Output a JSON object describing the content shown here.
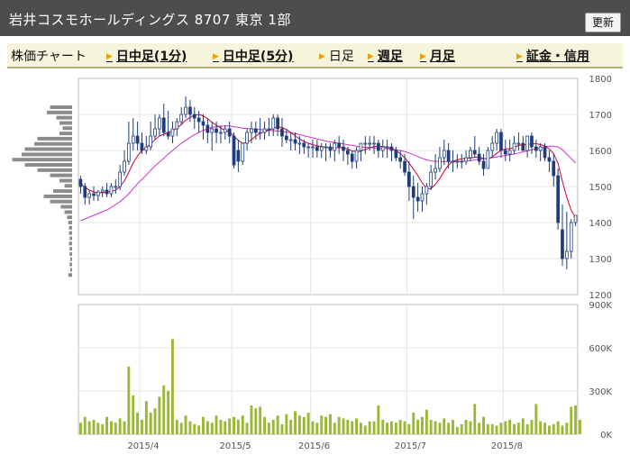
{
  "header": {
    "title": "岩井コスモホールディングス  8707  東京 1部",
    "refresh_label": "更新"
  },
  "tabs": [
    {
      "label": "株価チャート",
      "link": false,
      "arrow": false
    },
    {
      "label": "日中足(1分)",
      "link": true,
      "arrow": true
    },
    {
      "label": "日中足(5分)",
      "link": true,
      "arrow": true
    },
    {
      "label": "日足",
      "link": false,
      "arrow": true
    },
    {
      "label": "週足",
      "link": true,
      "arrow": true
    },
    {
      "label": "月足",
      "link": true,
      "arrow": true
    },
    {
      "label": "証金・信用",
      "link": true,
      "arrow": true
    }
  ],
  "colors": {
    "up_candle": "#ffffff",
    "down_candle": "#1f3d7a",
    "ma_short": "#cc0033",
    "ma_long": "#cc33cc",
    "volume": "#99b833",
    "grid": "#e6e6e6",
    "profile": "#8c8c8c"
  },
  "chart_data": [
    {
      "type": "candlestick",
      "title": "",
      "ylim": [
        1200,
        1800
      ],
      "yticks": [
        "1800",
        "1700",
        "1600",
        "1500",
        "1400",
        "1300",
        "1200"
      ],
      "xticks": [
        "2015/4",
        "2015/5",
        "2015/6",
        "2015/7",
        "2015/8"
      ],
      "x": [
        "2015/3/12",
        "2015/3/13",
        "2015/3/16",
        "2015/3/17",
        "2015/3/18",
        "2015/3/19",
        "2015/3/20",
        "2015/3/23",
        "2015/3/24",
        "2015/3/25",
        "2015/3/26",
        "2015/3/27",
        "2015/3/30",
        "2015/3/31",
        "2015/4/1",
        "2015/4/2",
        "2015/4/3",
        "2015/4/6",
        "2015/4/7",
        "2015/4/8",
        "2015/4/9",
        "2015/4/10",
        "2015/4/13",
        "2015/4/14",
        "2015/4/15",
        "2015/4/16",
        "2015/4/17",
        "2015/4/20",
        "2015/4/21",
        "2015/4/22",
        "2015/4/23",
        "2015/4/24",
        "2015/4/27",
        "2015/4/28",
        "2015/4/30",
        "2015/5/1",
        "2015/5/7",
        "2015/5/8",
        "2015/5/11",
        "2015/5/12",
        "2015/5/13",
        "2015/5/14",
        "2015/5/15",
        "2015/5/18",
        "2015/5/19",
        "2015/5/20",
        "2015/5/21",
        "2015/5/22",
        "2015/5/25",
        "2015/5/26",
        "2015/5/27",
        "2015/5/28",
        "2015/5/29",
        "2015/6/1",
        "2015/6/2",
        "2015/6/3",
        "2015/6/4",
        "2015/6/5",
        "2015/6/8",
        "2015/6/9",
        "2015/6/10",
        "2015/6/11",
        "2015/6/12",
        "2015/6/15",
        "2015/6/16",
        "2015/6/17",
        "2015/6/18",
        "2015/6/19",
        "2015/6/22",
        "2015/6/23",
        "2015/6/24",
        "2015/6/25",
        "2015/6/26",
        "2015/6/29",
        "2015/6/30",
        "2015/7/1",
        "2015/7/2",
        "2015/7/3",
        "2015/7/6",
        "2015/7/7",
        "2015/7/8",
        "2015/7/9",
        "2015/7/10",
        "2015/7/13",
        "2015/7/14",
        "2015/7/15",
        "2015/7/16",
        "2015/7/17",
        "2015/7/21",
        "2015/7/22",
        "2015/7/23",
        "2015/7/24",
        "2015/7/27",
        "2015/7/28",
        "2015/7/29",
        "2015/7/30",
        "2015/7/31",
        "2015/8/3",
        "2015/8/4",
        "2015/8/5",
        "2015/8/6",
        "2015/8/7",
        "2015/8/10",
        "2015/8/11",
        "2015/8/12",
        "2015/8/13",
        "2015/8/14",
        "2015/8/17",
        "2015/8/18",
        "2015/8/19",
        "2015/8/20",
        "2015/8/21",
        "2015/8/24",
        "2015/8/25",
        "2015/8/26",
        "2015/8/27"
      ],
      "open": [
        1520,
        1500,
        1470,
        1480,
        1475,
        1485,
        1490,
        1480,
        1500,
        1500,
        1540,
        1570,
        1620,
        1640,
        1620,
        1600,
        1610,
        1640,
        1660,
        1690,
        1650,
        1640,
        1660,
        1680,
        1700,
        1720,
        1700,
        1690,
        1680,
        1670,
        1650,
        1660,
        1650,
        1650,
        1660,
        1640,
        1600,
        1570,
        1620,
        1650,
        1660,
        1650,
        1650,
        1660,
        1660,
        1690,
        1660,
        1640,
        1630,
        1630,
        1620,
        1620,
        1610,
        1610,
        1610,
        1600,
        1610,
        1610,
        1600,
        1620,
        1610,
        1600,
        1590,
        1570,
        1600,
        1620,
        1620,
        1620,
        1620,
        1600,
        1610,
        1610,
        1600,
        1580,
        1570,
        1540,
        1500,
        1470,
        1460,
        1480,
        1500,
        1540,
        1550,
        1580,
        1600,
        1570,
        1570,
        1570,
        1570,
        1580,
        1600,
        1590,
        1570,
        1550,
        1600,
        1620,
        1650,
        1600,
        1590,
        1600,
        1620,
        1620,
        1600,
        1640,
        1610,
        1600,
        1610,
        1580,
        1570,
        1530,
        1380,
        1300,
        1320,
        1400
      ],
      "high": [
        1530,
        1510,
        1490,
        1500,
        1490,
        1500,
        1510,
        1510,
        1520,
        1560,
        1600,
        1680,
        1690,
        1680,
        1650,
        1640,
        1680,
        1700,
        1700,
        1730,
        1710,
        1680,
        1690,
        1720,
        1750,
        1740,
        1720,
        1710,
        1700,
        1690,
        1680,
        1680,
        1670,
        1670,
        1680,
        1650,
        1630,
        1620,
        1660,
        1680,
        1680,
        1690,
        1680,
        1690,
        1700,
        1700,
        1690,
        1660,
        1650,
        1650,
        1640,
        1630,
        1620,
        1630,
        1630,
        1620,
        1620,
        1620,
        1630,
        1640,
        1630,
        1610,
        1600,
        1610,
        1620,
        1640,
        1640,
        1640,
        1630,
        1630,
        1630,
        1620,
        1610,
        1600,
        1590,
        1570,
        1530,
        1510,
        1500,
        1510,
        1560,
        1590,
        1610,
        1630,
        1620,
        1600,
        1590,
        1590,
        1600,
        1610,
        1640,
        1610,
        1590,
        1610,
        1640,
        1660,
        1660,
        1630,
        1630,
        1640,
        1650,
        1640,
        1640,
        1650,
        1630,
        1620,
        1620,
        1600,
        1590,
        1550,
        1450,
        1430,
        1410,
        1420
      ],
      "low": [
        1480,
        1450,
        1450,
        1460,
        1460,
        1470,
        1470,
        1470,
        1480,
        1490,
        1530,
        1560,
        1600,
        1600,
        1590,
        1590,
        1600,
        1630,
        1640,
        1640,
        1630,
        1620,
        1640,
        1670,
        1690,
        1680,
        1660,
        1650,
        1630,
        1620,
        1600,
        1620,
        1620,
        1630,
        1620,
        1550,
        1540,
        1560,
        1600,
        1620,
        1630,
        1630,
        1630,
        1640,
        1640,
        1640,
        1610,
        1620,
        1600,
        1600,
        1590,
        1590,
        1580,
        1580,
        1580,
        1580,
        1570,
        1580,
        1570,
        1590,
        1570,
        1560,
        1550,
        1550,
        1570,
        1590,
        1600,
        1590,
        1580,
        1580,
        1580,
        1570,
        1570,
        1550,
        1530,
        1460,
        1410,
        1430,
        1430,
        1450,
        1490,
        1520,
        1540,
        1560,
        1550,
        1540,
        1550,
        1550,
        1560,
        1570,
        1580,
        1560,
        1530,
        1550,
        1580,
        1600,
        1580,
        1570,
        1570,
        1590,
        1600,
        1600,
        1580,
        1590,
        1580,
        1570,
        1570,
        1540,
        1500,
        1380,
        1280,
        1270,
        1300,
        1390
      ],
      "close": [
        1500,
        1470,
        1480,
        1475,
        1485,
        1490,
        1480,
        1500,
        1500,
        1540,
        1570,
        1620,
        1640,
        1620,
        1600,
        1610,
        1640,
        1660,
        1690,
        1650,
        1640,
        1660,
        1680,
        1700,
        1720,
        1700,
        1690,
        1680,
        1670,
        1650,
        1660,
        1650,
        1650,
        1660,
        1640,
        1560,
        1570,
        1620,
        1650,
        1660,
        1650,
        1650,
        1660,
        1660,
        1690,
        1660,
        1640,
        1630,
        1630,
        1620,
        1620,
        1610,
        1610,
        1610,
        1600,
        1610,
        1610,
        1600,
        1620,
        1610,
        1600,
        1590,
        1570,
        1600,
        1620,
        1620,
        1620,
        1620,
        1600,
        1610,
        1610,
        1600,
        1580,
        1570,
        1540,
        1500,
        1470,
        1460,
        1480,
        1500,
        1540,
        1550,
        1580,
        1600,
        1570,
        1570,
        1570,
        1570,
        1580,
        1600,
        1590,
        1570,
        1550,
        1600,
        1620,
        1650,
        1600,
        1590,
        1600,
        1620,
        1620,
        1600,
        1640,
        1610,
        1600,
        1610,
        1580,
        1570,
        1530,
        1400,
        1300,
        1320,
        1400,
        1420
      ],
      "ma_short": [
        1508,
        1498,
        1490,
        1485,
        1482,
        1483,
        1484,
        1486,
        1490,
        1500,
        1515,
        1540,
        1565,
        1585,
        1600,
        1608,
        1618,
        1630,
        1640,
        1645,
        1650,
        1655,
        1662,
        1672,
        1684,
        1692,
        1698,
        1700,
        1696,
        1688,
        1678,
        1670,
        1662,
        1656,
        1652,
        1640,
        1628,
        1620,
        1622,
        1630,
        1640,
        1648,
        1652,
        1656,
        1662,
        1665,
        1664,
        1658,
        1650,
        1640,
        1632,
        1625,
        1620,
        1616,
        1613,
        1611,
        1609,
        1607,
        1607,
        1608,
        1607,
        1604,
        1599,
        1596,
        1598,
        1603,
        1607,
        1611,
        1612,
        1611,
        1609,
        1606,
        1600,
        1591,
        1580,
        1565,
        1548,
        1530,
        1510,
        1494,
        1494,
        1506,
        1522,
        1542,
        1560,
        1570,
        1574,
        1577,
        1578,
        1579,
        1581,
        1582,
        1578,
        1576,
        1582,
        1592,
        1601,
        1604,
        1605,
        1608,
        1614,
        1616,
        1616,
        1619,
        1619,
        1616,
        1613,
        1604,
        1591,
        1564,
        1514,
        1470,
        1434,
        1414
      ],
      "ma_long": [
        1405,
        1410,
        1415,
        1420,
        1425,
        1430,
        1435,
        1442,
        1450,
        1458,
        1468,
        1480,
        1494,
        1508,
        1520,
        1532,
        1545,
        1557,
        1568,
        1578,
        1590,
        1600,
        1610,
        1620,
        1628,
        1636,
        1644,
        1650,
        1656,
        1660,
        1664,
        1666,
        1667,
        1668,
        1668,
        1666,
        1664,
        1662,
        1661,
        1660,
        1659,
        1658,
        1657,
        1656,
        1655,
        1654,
        1653,
        1651,
        1649,
        1647,
        1644,
        1641,
        1638,
        1635,
        1632,
        1629,
        1626,
        1624,
        1622,
        1620,
        1618,
        1616,
        1614,
        1612,
        1610,
        1609,
        1608,
        1607,
        1606,
        1606,
        1605,
        1604,
        1602,
        1600,
        1597,
        1593,
        1588,
        1583,
        1578,
        1574,
        1571,
        1570,
        1569,
        1569,
        1569,
        1569,
        1569,
        1570,
        1571,
        1572,
        1574,
        1576,
        1577,
        1578,
        1580,
        1582,
        1584,
        1586,
        1588,
        1590,
        1593,
        1596,
        1599,
        1602,
        1605,
        1608,
        1611,
        1612,
        1612,
        1610,
        1602,
        1590,
        1578,
        1565
      ]
    },
    {
      "type": "bar",
      "title": "",
      "ylim": [
        0,
        900000
      ],
      "yticks": [
        "900K",
        "600K",
        "300K",
        "0K"
      ],
      "values": [
        80000,
        120000,
        90000,
        100000,
        80000,
        70000,
        120000,
        90000,
        80000,
        110000,
        90000,
        470000,
        270000,
        150000,
        100000,
        230000,
        150000,
        180000,
        260000,
        340000,
        300000,
        660000,
        100000,
        80000,
        130000,
        90000,
        70000,
        60000,
        120000,
        90000,
        80000,
        130000,
        100000,
        90000,
        110000,
        120000,
        100000,
        130000,
        80000,
        200000,
        180000,
        190000,
        120000,
        80000,
        100000,
        130000,
        70000,
        140000,
        100000,
        160000,
        130000,
        120000,
        150000,
        90000,
        80000,
        130000,
        120000,
        140000,
        80000,
        120000,
        110000,
        100000,
        90000,
        110000,
        80000,
        60000,
        90000,
        90000,
        200000,
        100000,
        80000,
        90000,
        80000,
        100000,
        90000,
        70000,
        150000,
        100000,
        120000,
        170000,
        100000,
        90000,
        80000,
        110000,
        80000,
        100000,
        50000,
        70000,
        100000,
        90000,
        210000,
        80000,
        120000,
        70000,
        70000,
        60000,
        80000,
        90000,
        100000,
        70000,
        80000,
        110000,
        70000,
        100000,
        210000,
        90000,
        80000,
        60000,
        70000,
        90000,
        60000,
        80000,
        190000,
        200000,
        100000
      ]
    },
    {
      "type": "price-volume-profile",
      "values": [
        0.35,
        0.4,
        0.25,
        0.2,
        0.15,
        0.2,
        0.55,
        0.6,
        0.75,
        0.8,
        0.95,
        0.75,
        0.55,
        0.35,
        0.2,
        0.12,
        0.3,
        0.45,
        0.35,
        0.18,
        0.12,
        0.08,
        0.06,
        0.05,
        0.05,
        0.04,
        0.05,
        0.04,
        0.04,
        0.03,
        0.04,
        0.03,
        0.06
      ]
    }
  ]
}
